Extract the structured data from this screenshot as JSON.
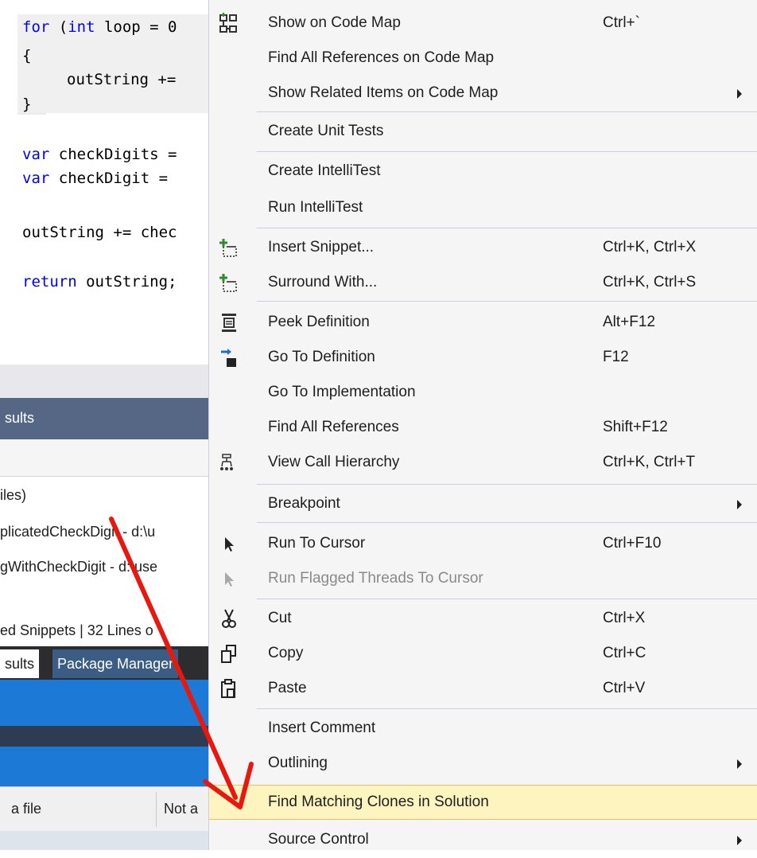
{
  "editor": {
    "lines": [
      {
        "kw": "for",
        "text": " (",
        "kw2": "int",
        "rest": " loop = 0"
      },
      {
        "text": "{"
      },
      {
        "text": "outString +="
      },
      {
        "text": "}"
      },
      {
        "kw": "var",
        "rest": " checkDigits ="
      },
      {
        "kw": "var",
        "rest": " checkDigit ="
      },
      {
        "text": "outString += chec"
      },
      {
        "kw": "return",
        "rest": " outString;"
      }
    ]
  },
  "results_panel": {
    "tab_title": "sults",
    "lines": [
      "iles)",
      "plicatedCheckDigit - d:\\u",
      "gWithCheckDigit - d:\\use"
    ],
    "status": "ed Snippets  |  32 Lines o",
    "tabs": [
      {
        "label": "sults"
      },
      {
        "label": "Package Manager"
      }
    ],
    "grid": {
      "col1": "a file",
      "col2": "Not a"
    }
  },
  "menu": {
    "items": [
      {
        "id": "show-on-code-map",
        "label": "Show on Code Map",
        "shortcut": "Ctrl+`",
        "icon": "code-map-icon"
      },
      {
        "id": "find-all-references-on-code-map",
        "label": "Find All References on Code Map",
        "shortcut": ""
      },
      {
        "id": "show-related-items-on-code-map",
        "label": "Show Related Items on Code Map",
        "shortcut": "",
        "submenu": true
      },
      {
        "id": "create-unit-tests",
        "label": "Create Unit Tests",
        "shortcut": ""
      },
      {
        "id": "create-intellitest",
        "label": "Create IntelliTest",
        "shortcut": ""
      },
      {
        "id": "run-intellitest",
        "label": "Run IntelliTest",
        "shortcut": ""
      },
      {
        "id": "insert-snippet",
        "label": "Insert Snippet...",
        "shortcut": "Ctrl+K, Ctrl+X",
        "icon": "insert-snippet-icon"
      },
      {
        "id": "surround-with",
        "label": "Surround With...",
        "shortcut": "Ctrl+K, Ctrl+S",
        "icon": "surround-with-icon"
      },
      {
        "id": "peek-definition",
        "label": "Peek Definition",
        "shortcut": "Alt+F12",
        "icon": "peek-definition-icon"
      },
      {
        "id": "go-to-definition",
        "label": "Go To Definition",
        "shortcut": "F12",
        "icon": "go-to-definition-icon"
      },
      {
        "id": "go-to-implementation",
        "label": "Go To Implementation",
        "shortcut": ""
      },
      {
        "id": "find-all-references",
        "label": "Find All References",
        "shortcut": "Shift+F12"
      },
      {
        "id": "view-call-hierarchy",
        "label": "View Call Hierarchy",
        "shortcut": "Ctrl+K, Ctrl+T",
        "icon": "call-hierarchy-icon"
      },
      {
        "id": "breakpoint",
        "label": "Breakpoint",
        "shortcut": "",
        "submenu": true
      },
      {
        "id": "run-to-cursor",
        "label": "Run To Cursor",
        "shortcut": "Ctrl+F10",
        "icon": "cursor-icon"
      },
      {
        "id": "run-flagged-threads-to-cursor",
        "label": "Run Flagged Threads To Cursor",
        "shortcut": "",
        "disabled": true,
        "icon": "cursor-icon"
      },
      {
        "id": "cut",
        "label": "Cut",
        "shortcut": "Ctrl+X",
        "icon": "scissors-icon"
      },
      {
        "id": "copy",
        "label": "Copy",
        "shortcut": "Ctrl+C",
        "icon": "copy-icon"
      },
      {
        "id": "paste",
        "label": "Paste",
        "shortcut": "Ctrl+V",
        "icon": "paste-icon"
      },
      {
        "id": "insert-comment",
        "label": "Insert Comment",
        "shortcut": ""
      },
      {
        "id": "outlining",
        "label": "Outlining",
        "shortcut": "",
        "submenu": true
      },
      {
        "id": "find-matching-clones-in-solution",
        "label": "Find Matching Clones in Solution",
        "shortcut": "",
        "hovered": true
      },
      {
        "id": "source-control",
        "label": "Source Control",
        "shortcut": "",
        "submenu": true
      }
    ]
  },
  "colors": {
    "menu_bg": "#f5f5f5",
    "hover_bg": "#fdf4bf",
    "annotation_arrow": "#e8180f",
    "keyword": "#0000ff"
  }
}
